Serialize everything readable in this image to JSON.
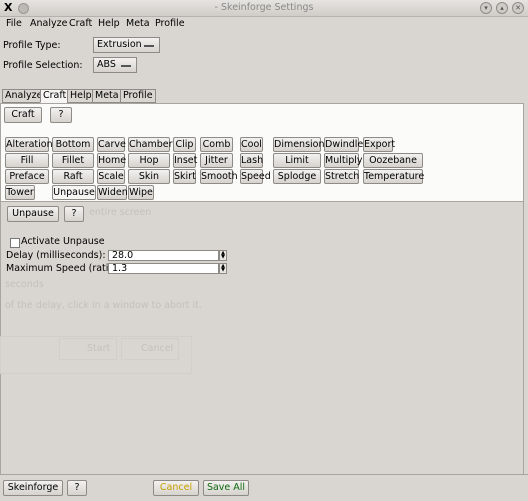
{
  "window": {
    "title": "- Skeinforge Settings",
    "logo": "X"
  },
  "menu": [
    "File",
    "Analyze",
    "Craft",
    "Help",
    "Meta",
    "Profile"
  ],
  "profile": {
    "type_label": "Profile Type:",
    "type_value": "Extrusion",
    "selection_label": "Profile Selection:",
    "selection_value": "ABS"
  },
  "tabs": [
    "Analyze",
    "Craft",
    "Help",
    "Meta",
    "Profile"
  ],
  "active_tab": "Craft",
  "craft_header": {
    "label": "Craft",
    "help": "?"
  },
  "plugins": [
    [
      "Alteration",
      "Bottom",
      "Carve",
      "Chamber",
      "Clip",
      "Comb",
      "Cool",
      "Dimension",
      "Dwindle",
      "Export"
    ],
    [
      "Fill",
      "Fillet",
      "Home",
      "Hop",
      "Inset",
      "Jitter",
      "Lash",
      "Limit",
      "Multiply",
      "Oozebane"
    ],
    [
      "Preface",
      "Raft",
      "Scale",
      "Skin",
      "Skirt",
      "Smooth",
      "Speed",
      "Splodge",
      "Stretch",
      "Temperature"
    ],
    [
      "Tower",
      "Unpause",
      "Widen",
      "Wipe"
    ]
  ],
  "selected_plugin": "Unpause",
  "unpause": {
    "label": "Unpause",
    "help": "?",
    "activate_label": "Activate Unpause",
    "activate_checked": false,
    "delay_label": "Delay (milliseconds):",
    "delay_value": "28.0",
    "max_speed_label": "Maximum Speed (ratio):",
    "max_speed_value": "1.3"
  },
  "ghost": {
    "screen": "entire screen",
    "seconds": "seconds",
    "delay_hint": "of the delay, click in a window to abort it.",
    "start": "Start",
    "cancel": "Cancel"
  },
  "bottom": {
    "skeinforge": "Skeinforge",
    "help": "?",
    "cancel": "Cancel",
    "save_all": "Save All"
  },
  "colors": {
    "cancel_text": "#c8a000",
    "save_text": "#0f6a0f"
  }
}
